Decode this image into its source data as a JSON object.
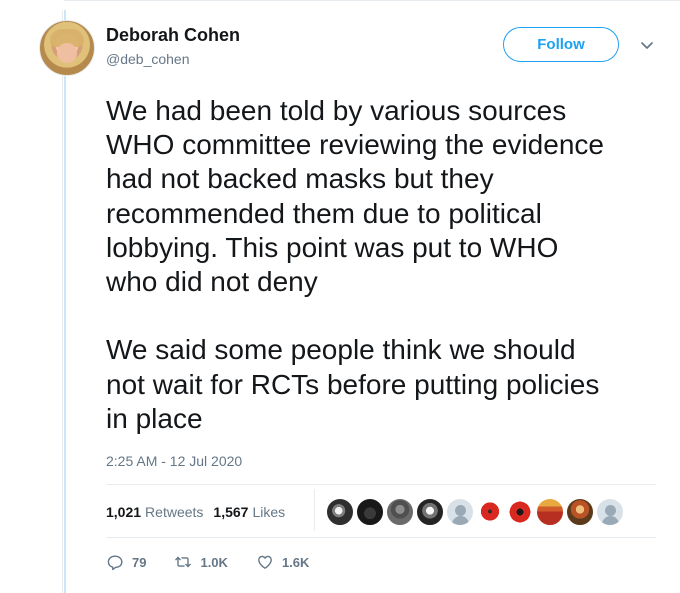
{
  "author": {
    "name": "Deborah Cohen",
    "handle": "@deb_cohen"
  },
  "header": {
    "follow_label": "Follow",
    "menu_icon": "chevron-down-icon"
  },
  "tweet": {
    "text": "We had been told by various sources\nWHO committee reviewing the evidence\nhad not backed masks but they\nrecommended them due to political\nlobbying. This point was put to WHO\nwho did not deny\n\nWe said some people think we should\nnot wait for RCTs before putting policies\nin place",
    "timestamp": "2:25 AM - 12 Jul 2020"
  },
  "stats": {
    "retweets_count": "1,021",
    "retweets_label": "Retweets",
    "likes_count": "1,567",
    "likes_label": "Likes"
  },
  "likers": [
    "profile-photo",
    "profile-photo",
    "profile-photo",
    "profile-photo",
    "default-avatar",
    "profile-photo",
    "profile-photo",
    "profile-photo",
    "profile-photo",
    "default-avatar"
  ],
  "actions": {
    "reply_count": "79",
    "retweet_count": "1.0K",
    "like_count": "1.6K"
  },
  "colors": {
    "accent": "#1da1f2",
    "text": "#14171a",
    "muted": "#657786",
    "divider": "#e6ecf0"
  }
}
